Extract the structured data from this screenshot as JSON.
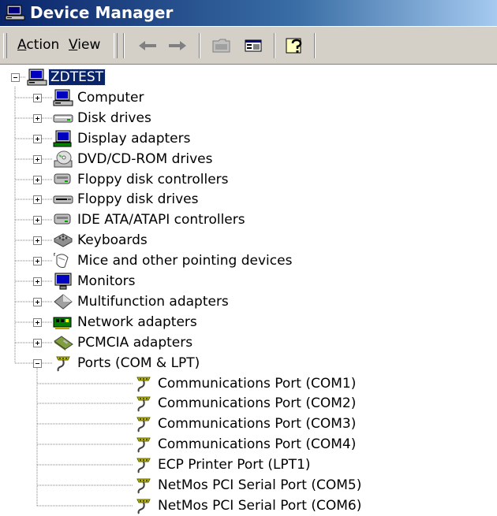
{
  "window": {
    "title": "Device Manager"
  },
  "menu": {
    "action": {
      "accel": "A",
      "rest": "ction"
    },
    "view": {
      "accel": "V",
      "rest": "iew"
    }
  },
  "toolbar": {
    "buttons": [
      "back-icon",
      "forward-icon",
      "up-folder-icon",
      "show-hide-tree-icon",
      "help-icon"
    ]
  },
  "tree": {
    "root": {
      "label": "ZDTEST",
      "icon": "computer-icon",
      "expanded": true,
      "selected": true
    },
    "categories": [
      {
        "label": "Computer",
        "icon": "computer-icon",
        "expanded": false
      },
      {
        "label": "Disk drives",
        "icon": "disk-drive-icon",
        "expanded": false
      },
      {
        "label": "Display adapters",
        "icon": "display-adapter-icon",
        "expanded": false
      },
      {
        "label": "DVD/CD-ROM drives",
        "icon": "cdrom-icon",
        "expanded": false
      },
      {
        "label": "Floppy disk controllers",
        "icon": "controller-icon",
        "expanded": false
      },
      {
        "label": "Floppy disk drives",
        "icon": "floppy-drive-icon",
        "expanded": false
      },
      {
        "label": "IDE ATA/ATAPI controllers",
        "icon": "controller-icon",
        "expanded": false
      },
      {
        "label": "Keyboards",
        "icon": "keyboard-icon",
        "expanded": false
      },
      {
        "label": "Mice and other pointing devices",
        "icon": "mouse-icon",
        "expanded": false
      },
      {
        "label": "Monitors",
        "icon": "monitor-icon",
        "expanded": false
      },
      {
        "label": "Multifunction adapters",
        "icon": "multifunction-icon",
        "expanded": false
      },
      {
        "label": "Network adapters",
        "icon": "network-card-icon",
        "expanded": false
      },
      {
        "label": "PCMCIA adapters",
        "icon": "pcmcia-icon",
        "expanded": false
      },
      {
        "label": "Ports (COM & LPT)",
        "icon": "port-icon",
        "expanded": true
      }
    ],
    "ports": [
      {
        "label": "Communications Port (COM1)",
        "icon": "port-icon"
      },
      {
        "label": "Communications Port (COM2)",
        "icon": "port-icon"
      },
      {
        "label": "Communications Port (COM3)",
        "icon": "port-icon"
      },
      {
        "label": "Communications Port (COM4)",
        "icon": "port-icon"
      },
      {
        "label": "ECP Printer Port (LPT1)",
        "icon": "port-icon"
      },
      {
        "label": "NetMos PCI Serial Port (COM5)",
        "icon": "port-icon"
      },
      {
        "label": "NetMos PCI Serial Port (COM6)",
        "icon": "port-icon"
      }
    ]
  }
}
